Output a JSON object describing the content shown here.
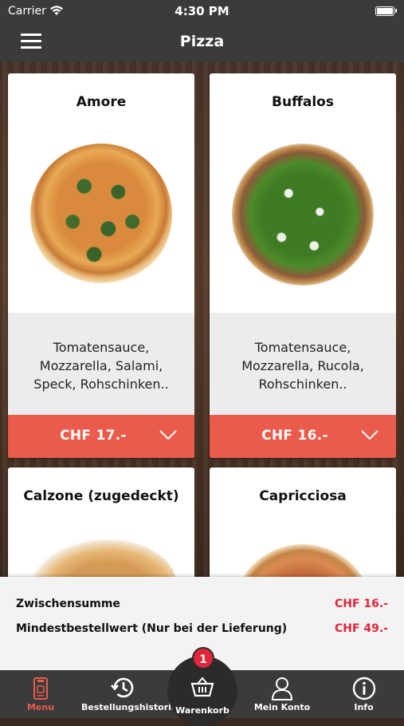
{
  "status_bar": {
    "carrier": "Carrier",
    "time": "4:30 PM"
  },
  "header": {
    "title": "Pizza",
    "menu_icon": "hamburger-icon"
  },
  "products": [
    {
      "name": "Amore",
      "description": "Tomatensauce, Mozzarella, Salami, Speck, Rohschinken..",
      "price": "CHF 17.-"
    },
    {
      "name": "Buffalos",
      "description": "Tomatensauce, Mozzarella, Rucola, Rohschinken..",
      "price": "CHF 16.-"
    },
    {
      "name": "Calzone (zugedeckt)"
    },
    {
      "name": "Capricciosa"
    }
  ],
  "summary": {
    "subtotal_label": "Zwischensumme",
    "subtotal_value": "CHF 16.-",
    "minimum_label": "Mindestbestellwert (Nur bei der Lieferung)",
    "minimum_value": "CHF 49.-"
  },
  "tabs": [
    {
      "label": "Menu",
      "icon": "phone-menu-icon",
      "active": true
    },
    {
      "label": "Bestellungshistorie",
      "icon": "history-icon"
    },
    {
      "label": "Warenkorb",
      "icon": "basket-icon",
      "badge": "1"
    },
    {
      "label": "Mein Konto",
      "icon": "user-icon"
    },
    {
      "label": "Info",
      "icon": "info-icon"
    }
  ],
  "colors": {
    "accent": "#ea5b4b",
    "price_red": "#e2263b",
    "bar_dark": "#3b3b3b"
  }
}
